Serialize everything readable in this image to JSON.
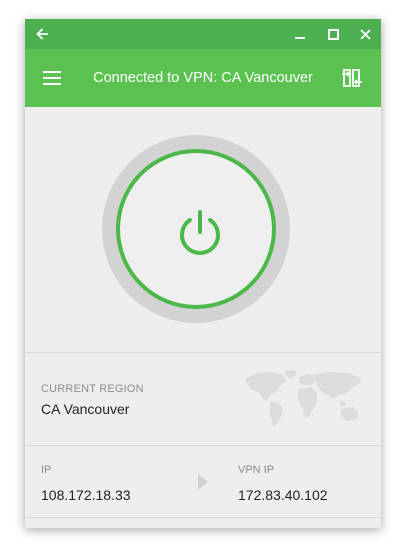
{
  "window": {
    "back_icon": "arrow-left-icon",
    "controls": [
      "minimize-icon",
      "maximize-icon",
      "close-icon"
    ]
  },
  "appbar": {
    "title": "Connected to VPN: CA Vancouver",
    "menu_icon": "hamburger-menu-icon",
    "switch_icon": "switch-server-icon"
  },
  "power": {
    "icon": "power-icon",
    "state": "connected"
  },
  "region": {
    "label": "CURRENT REGION",
    "value": "CA Vancouver",
    "map_icon": "world-map-icon"
  },
  "ip": {
    "label": "IP",
    "value": "108.172.18.33",
    "vpn_label": "VPN IP",
    "vpn_value": "172.83.40.102"
  },
  "colors": {
    "titlebar": "#4caf50",
    "appbar": "#5bc251",
    "ring": "#4cb84a",
    "ring_outer": "#d3d3d3",
    "background": "#eeeeee"
  }
}
